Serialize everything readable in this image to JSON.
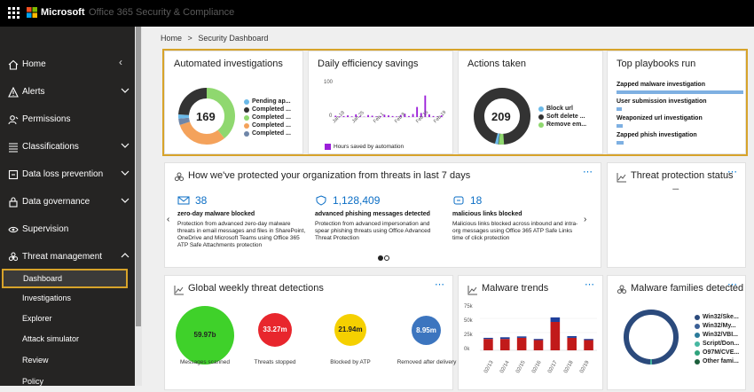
{
  "topbar": {
    "brand": "Microsoft",
    "app_name": "Office 365 Security & Compliance"
  },
  "sidebar": {
    "items": [
      {
        "label": "Home",
        "icon": "home-icon"
      },
      {
        "label": "Alerts",
        "icon": "alert-icon"
      },
      {
        "label": "Permissions",
        "icon": "permissions-icon"
      },
      {
        "label": "Classifications",
        "icon": "list-icon"
      },
      {
        "label": "Data loss prevention",
        "icon": "shield-icon"
      },
      {
        "label": "Data governance",
        "icon": "lock-icon"
      },
      {
        "label": "Supervision",
        "icon": "eye-icon"
      },
      {
        "label": "Threat management",
        "icon": "biohazard-icon"
      }
    ],
    "sub_items": [
      {
        "label": "Dashboard"
      },
      {
        "label": "Investigations"
      },
      {
        "label": "Explorer"
      },
      {
        "label": "Attack simulator"
      },
      {
        "label": "Review"
      },
      {
        "label": "Policy"
      }
    ]
  },
  "breadcrumb": {
    "home": "Home",
    "separator": ">",
    "current": "Security Dashboard"
  },
  "cards": {
    "automated": {
      "title": "Automated investigations",
      "total": "169",
      "legend": [
        "Pending ap...",
        "Completed ...",
        "Completed ...",
        "Completed ...",
        "Completed ..."
      ],
      "colors": [
        "#6ab9e8",
        "#333333",
        "#8fd86f",
        "#f4a25b",
        "#6f86a8"
      ]
    },
    "efficiency": {
      "title": "Daily efficiency savings",
      "legend": "Hours saved by automation",
      "y_ticks": [
        "100",
        "0"
      ],
      "x_ticks": [
        "Jan 18",
        "Jan 25",
        "Feb 1",
        "Feb 8",
        "Feb 15",
        "Feb 19"
      ]
    },
    "actions": {
      "title": "Actions taken",
      "total": "209",
      "legend": [
        "Block url",
        "Soft delete ...",
        "Remove em..."
      ],
      "colors": [
        "#6ab9e8",
        "#333333",
        "#8fd86f"
      ]
    },
    "playbooks": {
      "title": "Top playbooks run",
      "items": [
        {
          "label": "Zapped malware investigation",
          "value": 1.0
        },
        {
          "label": "User submission investigation",
          "value": 0.04
        },
        {
          "label": "Weaponized url investigation",
          "value": 0.05
        },
        {
          "label": "Zapped phish investigation",
          "value": 0.06
        }
      ]
    },
    "protected": {
      "title": "How we've protected your organization from threats in last 7 days",
      "more": "⋯",
      "stats": [
        {
          "number": "38",
          "title": "zero-day malware blocked",
          "desc": "Protection from advanced zero-day malware threats in email messages and files in SharePoint, OneDrive and Microsoft Teams using Office 365 ATP Safe Attachments protection"
        },
        {
          "number": "1,128,409",
          "title": "advanced phishing messages detected",
          "desc": "Protection from advanced impersonation and spear phishing threats using Office Advanced Threat Protection"
        },
        {
          "number": "18",
          "title": "malicious links blocked",
          "desc": "Malicious links blocked across inbound and intra-org messages using Office 365 ATP Safe Links time of click protection"
        }
      ],
      "page_dots": 2,
      "active_page": 1
    },
    "threat_status": {
      "title": "Threat protection status",
      "more": "⋯",
      "loading": "• • • • • •"
    },
    "weekly": {
      "title": "Global weekly threat detections",
      "more": "⋯",
      "bubbles": [
        {
          "value": "59.97b",
          "label": "Messages scanned",
          "color": "#3fd12a",
          "text_color": "#222"
        },
        {
          "value": "33.27m",
          "label": "Threats stopped",
          "color": "#e8262d",
          "text_color": "#fff"
        },
        {
          "value": "21.94m",
          "label": "Blocked by ATP",
          "color": "#f5d000",
          "text_color": "#222"
        },
        {
          "value": "8.95m",
          "label": "Removed after delivery",
          "color": "#3c75bf",
          "text_color": "#fff"
        }
      ]
    },
    "malware_trends": {
      "title": "Malware trends",
      "more": "⋯"
    },
    "families": {
      "title": "Malware families detected",
      "more": "⋯",
      "legend": [
        "Win32/Ske...",
        "Win32/My...",
        "Win32/VBI...",
        "Script/Don...",
        "O97M/CVE...",
        "Other fami..."
      ],
      "colors": [
        "#2b4a7c",
        "#3a5f96",
        "#2a7a9a",
        "#46b7a1",
        "#2ea37c",
        "#1b5e3b"
      ]
    }
  },
  "chart_data": [
    {
      "type": "bar",
      "title": "Daily efficiency savings",
      "series": [
        {
          "name": "Hours saved by automation",
          "color": "#9b1fd9",
          "values": [
            4,
            2,
            3,
            5,
            2,
            8,
            3,
            1,
            6,
            4,
            2,
            3,
            7,
            5,
            3,
            2,
            6,
            10,
            3,
            9,
            30,
            12,
            64,
            8,
            3,
            2,
            5
          ]
        }
      ],
      "x_ticks": [
        "Jan 18",
        "Jan 25",
        "Feb 1",
        "Feb 8",
        "Feb 15",
        "Feb 19"
      ],
      "ylim": [
        0,
        100
      ]
    },
    {
      "type": "bar",
      "title": "Malware trends",
      "categories": [
        "02/13",
        "02/14",
        "02/15",
        "02/16",
        "02/17",
        "02/18",
        "02/19"
      ],
      "y_ticks": [
        "75k",
        "50k",
        "25k",
        "0k"
      ],
      "ylim": [
        0,
        75000
      ],
      "series": [
        {
          "color": "#c11a1a",
          "values": [
            20000,
            20000,
            22000,
            18000,
            50000,
            22000,
            18000
          ]
        },
        {
          "color": "#1f3f9a",
          "values": [
            2000,
            3000,
            2500,
            2000,
            8000,
            3000,
            2000
          ]
        }
      ]
    }
  ]
}
